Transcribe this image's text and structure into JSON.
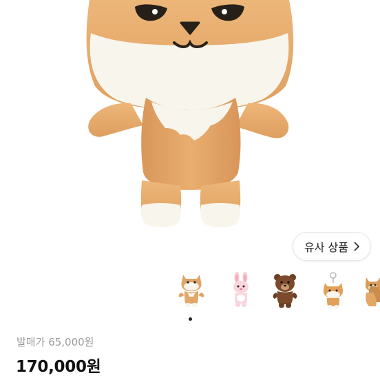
{
  "product": {
    "original_price_label": "발매가",
    "original_price": "65,000원",
    "price": "170,000원"
  },
  "similar": {
    "button_label": "유사 상품",
    "thumbnails": [
      {
        "icon": "orange-fox-plush-icon"
      },
      {
        "icon": "pink-bunny-plush-icon"
      },
      {
        "icon": "brown-bear-plush-icon"
      },
      {
        "icon": "fox-keyring-plush-icon"
      },
      {
        "icon": "fox-pair-plush-icon"
      }
    ]
  },
  "colors": {
    "fur": "#E0A466",
    "cream": "#F8F5EC",
    "text_primary": "#111111",
    "text_muted": "#9A9A9A"
  }
}
